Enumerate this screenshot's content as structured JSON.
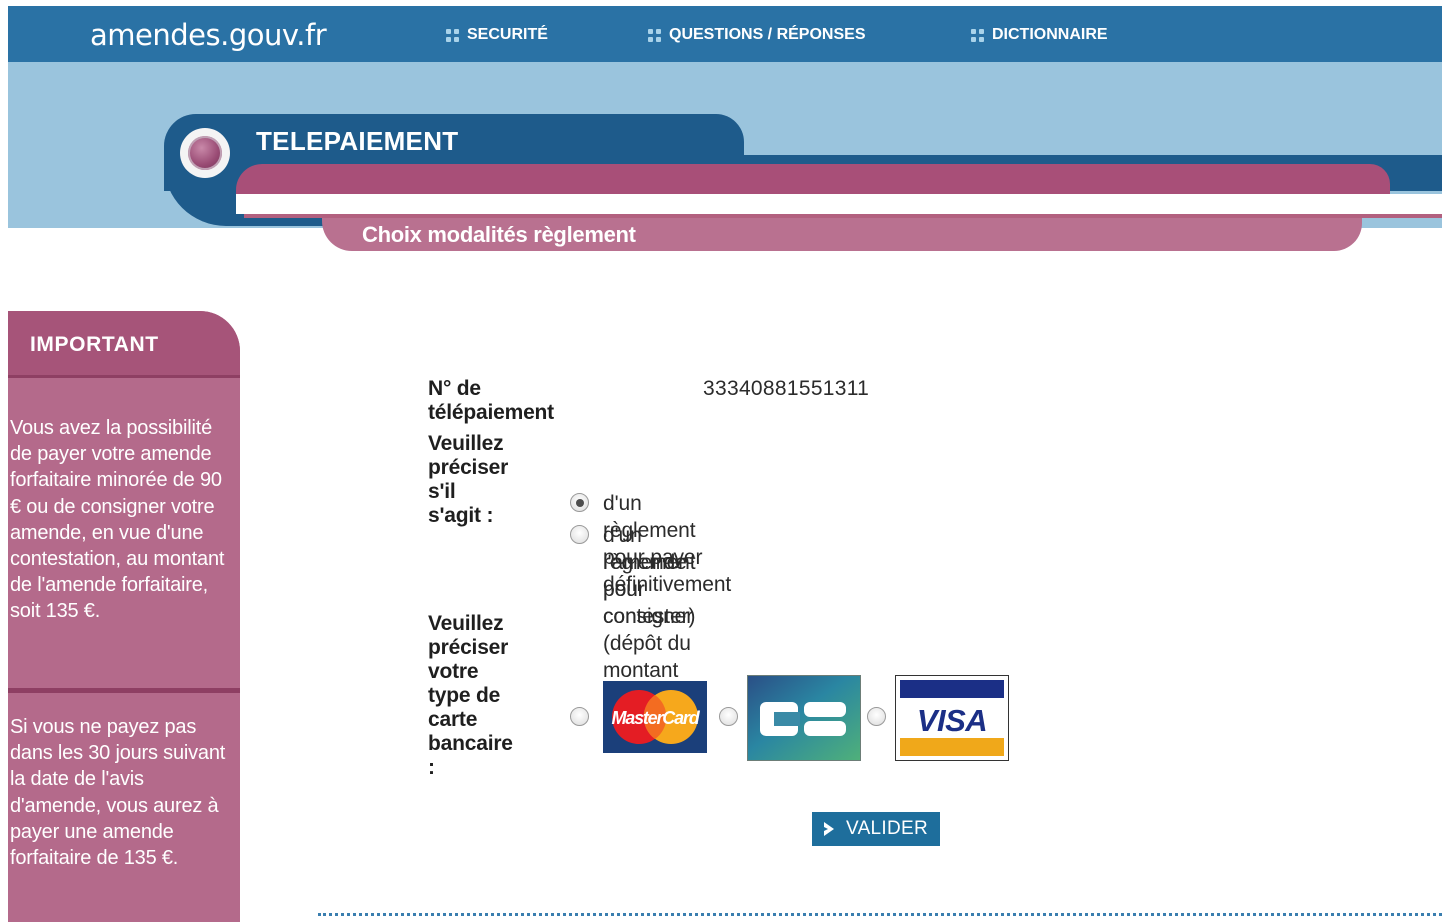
{
  "nav": {
    "logo": "amendes.gouv.fr",
    "items": [
      {
        "label": "SECURITÉ"
      },
      {
        "label": "QUESTIONS / RÉPONSES"
      },
      {
        "label": "DICTIONNAIRE"
      }
    ]
  },
  "header": {
    "title": "TELEPAIEMENT",
    "subtitle": "Choix modalités règlement"
  },
  "sidebar": {
    "heading": "IMPORTANT",
    "paragraph1": "Vous avez la possibilité de payer votre amende forfaitaire minorée de 90 € ou de consigner votre amende, en vue d'une contestation, au montant de l'amende forfaitaire, soit 135 €.",
    "paragraph2": "Si vous ne payez pas dans les 30 jours suivant la date de l'avis d'amende, vous aurez à payer une amende forfaitaire de 135 €."
  },
  "form": {
    "telepaiement_label": "N° de télépaiement",
    "telepaiement_value": "33340881551311",
    "question_type": "Veuillez préciser s'il s'agit :",
    "option1": "d'un règlement pour payer définitivement",
    "option2_line1": "d'un règlement pour consigner (dépôt du montant de",
    "option2_line2": "l'amende pour contester)",
    "question_card": "Veuillez préciser votre type de carte bancaire :",
    "cards": {
      "mastercard": "MasterCard",
      "cb": "CB",
      "visa": "VISA"
    },
    "submit_label": "VALIDER"
  },
  "state": {
    "selected_option": "option1",
    "selected_card": null
  },
  "colors": {
    "nav_blue": "#2a72a5",
    "band_light_blue": "#9ac4dd",
    "band_dark_blue": "#1e5b8b",
    "accent_pink": "#a84f78",
    "sidebar_pink": "#b46a8b"
  },
  "icons": {
    "nav_bullet": "dots-grid-icon",
    "header": "circle-badge-icon",
    "submit": "chevron-right-icon"
  }
}
